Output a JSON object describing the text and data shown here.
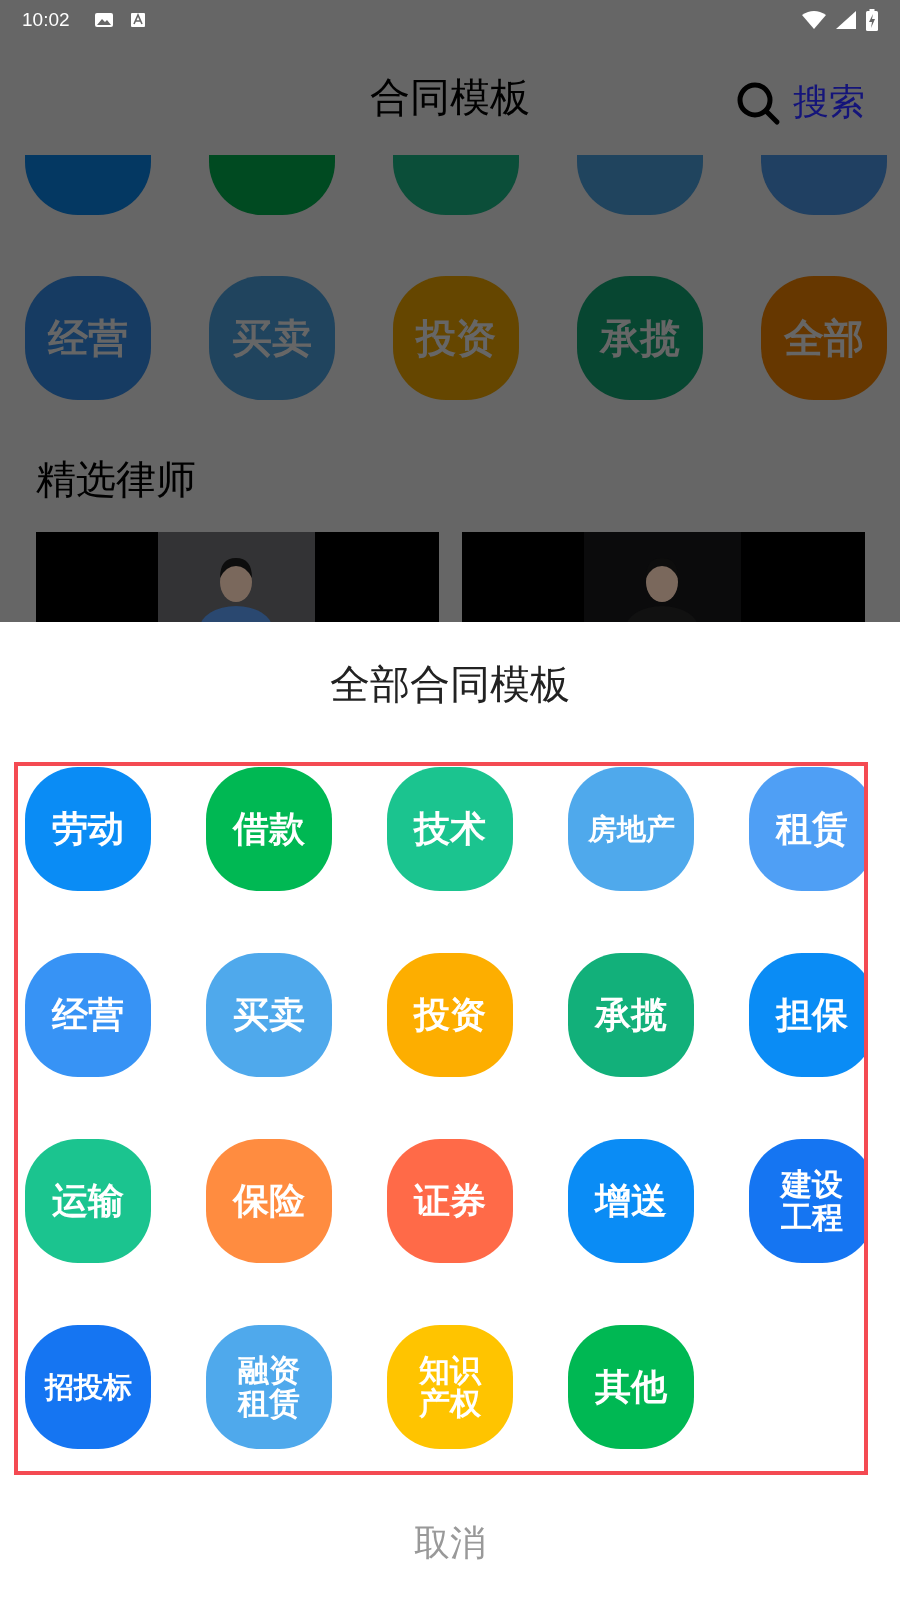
{
  "status_bar": {
    "time": "10:02"
  },
  "header": {
    "title": "合同模板",
    "search_label": "搜索"
  },
  "clipped_row": [
    {
      "color": "#043862"
    },
    {
      "color": "#004a21"
    },
    {
      "color": "#0b4e39"
    },
    {
      "color": "#20445e"
    },
    {
      "color": "#204062"
    }
  ],
  "background_categories": [
    {
      "label": "经营",
      "color": "#163b62"
    },
    {
      "label": "买卖",
      "color": "#20445e"
    },
    {
      "label": "投资",
      "color": "#654600"
    },
    {
      "label": "承揽",
      "color": "#074631"
    },
    {
      "label": "全部",
      "color": "#663700"
    }
  ],
  "lawyers": {
    "title": "精选律师"
  },
  "sheet": {
    "title": "全部合同模板",
    "categories": [
      {
        "label": "劳动",
        "color": "#0a8cf5"
      },
      {
        "label": "借款",
        "color": "#00b853"
      },
      {
        "label": "技术",
        "color": "#1bc48f"
      },
      {
        "label": "房地产",
        "color": "#4fa9ec"
      },
      {
        "label": "租赁",
        "color": "#4f9ff5"
      },
      {
        "label": "经营",
        "color": "#3793f5"
      },
      {
        "label": "买卖",
        "color": "#4fa9ec"
      },
      {
        "label": "投资",
        "color": "#fdae00"
      },
      {
        "label": "承揽",
        "color": "#12b07a"
      },
      {
        "label": "担保",
        "color": "#0a8cf5"
      },
      {
        "label": "运输",
        "color": "#1bc48f"
      },
      {
        "label": "保险",
        "color": "#ff8c40"
      },
      {
        "label": "证券",
        "color": "#ff6a48"
      },
      {
        "label": "增送",
        "color": "#0a8cf5"
      },
      {
        "label": "建设工程",
        "color": "#1575f2"
      },
      {
        "label": "招投标",
        "color": "#1575f2"
      },
      {
        "label": "融资租赁",
        "color": "#4fa9ec"
      },
      {
        "label": "知识产权",
        "color": "#ffc400"
      },
      {
        "label": "其他",
        "color": "#00b853"
      }
    ],
    "cancel": "取消"
  }
}
